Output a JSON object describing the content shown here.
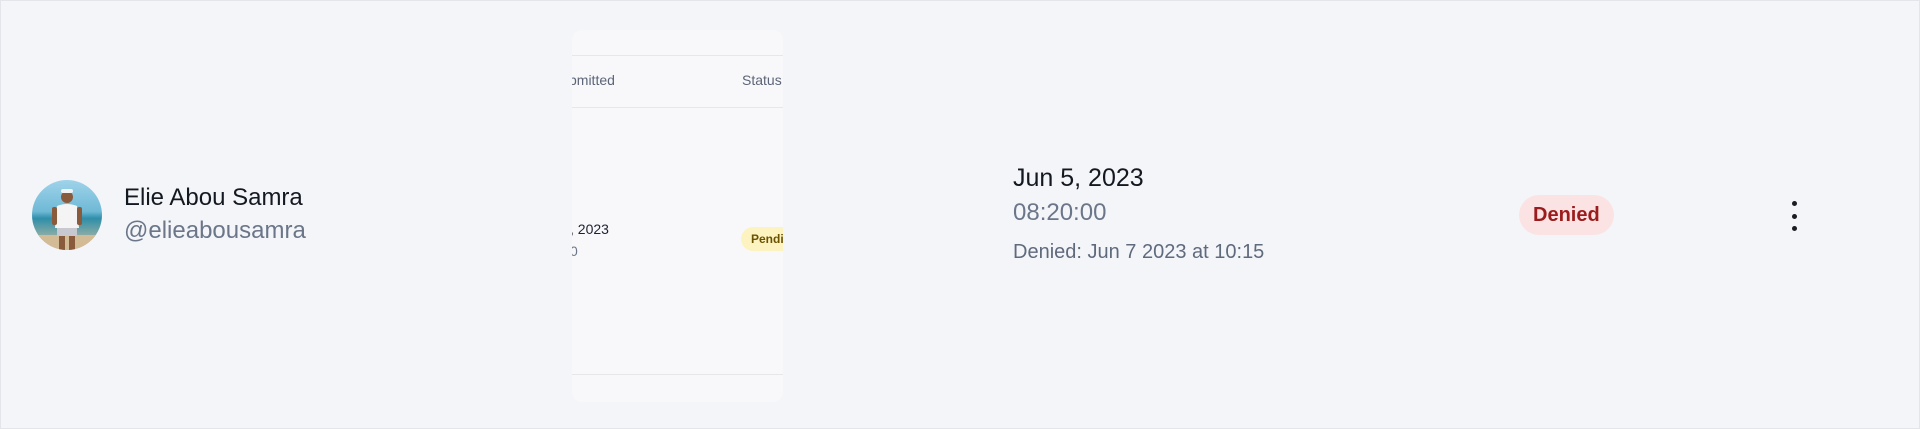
{
  "user": {
    "name": "Elie Abou Samra",
    "handle": "@elieabousamra"
  },
  "preview": {
    "columns": [
      "bmitted",
      "Status"
    ],
    "row": {
      "date": ", 2023",
      "time": "0",
      "status": "Pendi"
    }
  },
  "request": {
    "date": "Jun 5, 2023",
    "time": "08:20:00",
    "note": "Denied: Jun 7 2023 at 10:15"
  },
  "status": {
    "label": "Denied",
    "color": "#9b1c1c",
    "background": "#fbe3e3"
  },
  "actions": {
    "icon": "more-vertical-icon"
  }
}
